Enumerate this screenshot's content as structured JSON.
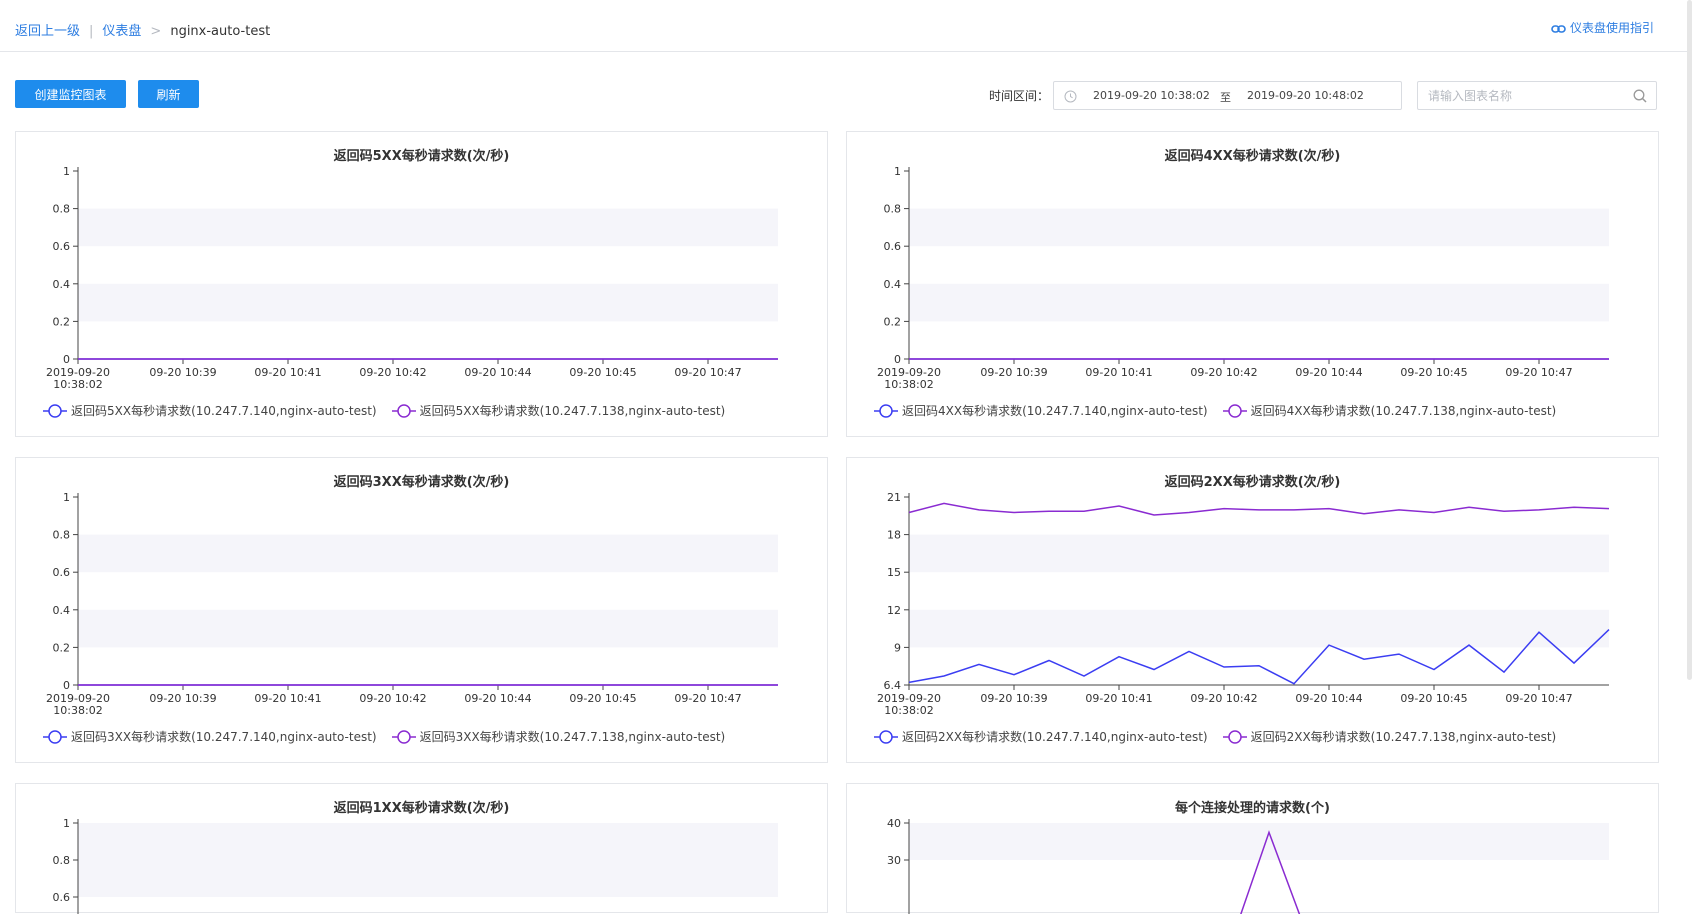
{
  "breadcrumb": {
    "back": "返回上一级",
    "dashboard": "仪表盘",
    "current": "nginx-auto-test"
  },
  "guide_link": "仪表盘使用指引",
  "toolbar": {
    "create_label": "创建监控图表",
    "refresh_label": "刷新"
  },
  "time_range": {
    "label": "时间区间：",
    "start": "2019-09-20 10:38:02",
    "to": "至",
    "end": "2019-09-20 10:48:02"
  },
  "search": {
    "placeholder": "请输入图表名称",
    "value": ""
  },
  "colors": {
    "accent": "#1e8ced",
    "series1": "#3b3df2",
    "series2": "#8a2bd1"
  },
  "x_ticks": [
    "2019-09-20\n10:38:02",
    "09-20 10:39",
    "09-20 10:41",
    "09-20 10:42",
    "09-20 10:44",
    "09-20 10:45",
    "09-20 10:47"
  ],
  "chart_data": [
    {
      "type": "line",
      "title": "返回码5XX每秒请求数(次/秒)",
      "yticks": [
        "0",
        "0.2",
        "0.4",
        "0.6",
        "0.8",
        "1"
      ],
      "ylim": [
        0,
        1
      ],
      "series": [
        {
          "name": "返回码5XX每秒请求数(10.247.7.140,nginx-auto-test)",
          "values": [
            0,
            0,
            0,
            0,
            0,
            0,
            0,
            0,
            0,
            0,
            0,
            0,
            0,
            0,
            0,
            0,
            0,
            0,
            0,
            0,
            0
          ]
        },
        {
          "name": "返回码5XX每秒请求数(10.247.7.138,nginx-auto-test)",
          "values": [
            0,
            0,
            0,
            0,
            0,
            0,
            0,
            0,
            0,
            0,
            0,
            0,
            0,
            0,
            0,
            0,
            0,
            0,
            0,
            0,
            0
          ]
        }
      ]
    },
    {
      "type": "line",
      "title": "返回码4XX每秒请求数(次/秒)",
      "yticks": [
        "0",
        "0.2",
        "0.4",
        "0.6",
        "0.8",
        "1"
      ],
      "ylim": [
        0,
        1
      ],
      "series": [
        {
          "name": "返回码4XX每秒请求数(10.247.7.140,nginx-auto-test)",
          "values": [
            0,
            0,
            0,
            0,
            0,
            0,
            0,
            0,
            0,
            0,
            0,
            0,
            0,
            0,
            0,
            0,
            0,
            0,
            0,
            0,
            0
          ]
        },
        {
          "name": "返回码4XX每秒请求数(10.247.7.138,nginx-auto-test)",
          "values": [
            0,
            0,
            0,
            0,
            0,
            0,
            0,
            0,
            0,
            0,
            0,
            0,
            0,
            0,
            0,
            0,
            0,
            0,
            0,
            0,
            0
          ]
        }
      ]
    },
    {
      "type": "line",
      "title": "返回码3XX每秒请求数(次/秒)",
      "yticks": [
        "0",
        "0.2",
        "0.4",
        "0.6",
        "0.8",
        "1"
      ],
      "ylim": [
        0,
        1
      ],
      "series": [
        {
          "name": "返回码3XX每秒请求数(10.247.7.140,nginx-auto-test)",
          "values": [
            0,
            0,
            0,
            0,
            0,
            0,
            0,
            0,
            0,
            0,
            0,
            0,
            0,
            0,
            0,
            0,
            0,
            0,
            0,
            0,
            0
          ]
        },
        {
          "name": "返回码3XX每秒请求数(10.247.7.138,nginx-auto-test)",
          "values": [
            0,
            0,
            0,
            0,
            0,
            0,
            0,
            0,
            0,
            0,
            0,
            0,
            0,
            0,
            0,
            0,
            0,
            0,
            0,
            0,
            0
          ]
        }
      ]
    },
    {
      "type": "line",
      "title": "返回码2XX每秒请求数(次/秒)",
      "yticks": [
        "6.4",
        "9",
        "12",
        "15",
        "18",
        "21"
      ],
      "ylim": [
        6.4,
        21
      ],
      "series": [
        {
          "name": "返回码2XX每秒请求数(10.247.7.140,nginx-auto-test)",
          "values": [
            6.6,
            7.1,
            8.0,
            7.2,
            8.3,
            7.1,
            8.6,
            7.6,
            9.0,
            7.8,
            7.9,
            6.5,
            9.5,
            8.4,
            8.8,
            7.6,
            9.5,
            7.4,
            10.5,
            8.1,
            10.7
          ]
        },
        {
          "name": "返回码2XX每秒请求数(10.247.7.138,nginx-auto-test)",
          "values": [
            19.8,
            20.5,
            20.0,
            19.8,
            19.9,
            19.9,
            20.3,
            19.6,
            19.8,
            20.1,
            20.0,
            20.0,
            20.1,
            19.7,
            20.0,
            19.8,
            20.2,
            19.9,
            20.0,
            20.2,
            20.1
          ]
        }
      ]
    },
    {
      "type": "line",
      "title": "返回码1XX每秒请求数(次/秒)",
      "yticks": [
        "0.6",
        "0.8",
        "1"
      ],
      "ylim": [
        0,
        1
      ],
      "series": []
    },
    {
      "type": "line",
      "title": "每个连接处理的请求数(个)",
      "yticks": [
        "30",
        "40"
      ],
      "ylim": [
        0,
        40
      ],
      "series": [
        {
          "values": [
            null,
            null,
            null,
            null,
            null,
            null,
            null,
            null,
            null,
            null,
            38,
            18
          ]
        }
      ]
    }
  ]
}
